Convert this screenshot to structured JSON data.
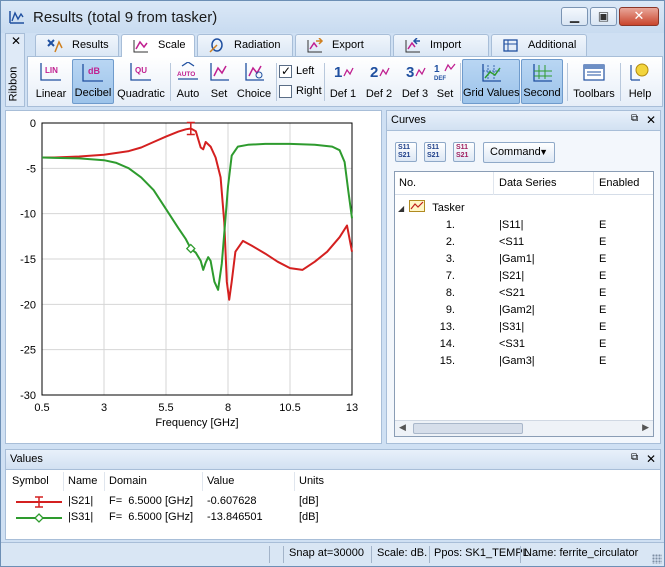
{
  "window": {
    "title": "Results (total 9 from tasker)"
  },
  "ribbon": {
    "side_label": "Ribbon",
    "tabs": [
      {
        "label": "Results"
      },
      {
        "label": "Scale"
      },
      {
        "label": "Radiation"
      },
      {
        "label": "Export"
      },
      {
        "label": "Import"
      },
      {
        "label": "Additional"
      }
    ],
    "active_tab": "Scale",
    "buttons": {
      "linear": "Linear",
      "decibel": "Decibel",
      "quadratic": "Quadratic",
      "auto": "Auto",
      "set": "Set",
      "choice": "Choice",
      "left": "Left",
      "right": "Right",
      "def1": "Def 1",
      "def2": "Def 2",
      "def3": "Def 3",
      "set2": "Set",
      "grid_values": "Grid Values",
      "second": "Second",
      "toolbars": "Toolbars",
      "help": "Help"
    },
    "icon_text": {
      "lin": "LIN",
      "db": "dB",
      "qu": "QU",
      "auto": "AUTO",
      "one": "1",
      "two": "2",
      "three": "3",
      "def": "DEF"
    },
    "left_checked": true,
    "right_checked": false
  },
  "chart_data": {
    "type": "line",
    "xlabel": "Frequency [GHz]",
    "ylabel": "",
    "xlim": [
      0.5,
      13
    ],
    "ylim": [
      -30,
      0
    ],
    "x_ticks": [
      "0.5",
      "3",
      "5.5",
      "8",
      "10.5",
      "13"
    ],
    "y_ticks": [
      "0",
      "-5",
      "-10",
      "-15",
      "-20",
      "-25",
      "-30"
    ],
    "grid": true,
    "marker_x": 6.5,
    "series": [
      {
        "name": "|S21|",
        "color": "#d42020",
        "x": [
          0.5,
          1,
          2,
          3,
          4,
          4.5,
          5,
          5.5,
          6,
          6.3,
          6.5,
          6.7,
          6.9,
          7.0,
          7.1,
          7.3,
          7.5,
          7.7,
          7.85,
          7.95,
          8.05,
          8.15,
          8.3,
          8.6,
          9,
          9.5,
          10,
          10.5,
          11,
          11.5,
          12,
          12.5,
          12.8,
          13
        ],
        "y": [
          -3.8,
          -3.8,
          -3.7,
          -3.5,
          -3.1,
          -2.7,
          -2.1,
          -1.5,
          -0.95,
          -0.7,
          -0.61,
          -0.9,
          -2.7,
          -2.9,
          -2.1,
          -2.6,
          -3.8,
          -6.0,
          -11.0,
          -17.5,
          -19.5,
          -17.5,
          -14.2,
          -13.0,
          -13.6,
          -14.4,
          -15.3,
          -16.0,
          -16.2,
          -15.3,
          -14.2,
          -12.6,
          -11.3,
          -14.2
        ]
      },
      {
        "name": "|S31|",
        "color": "#2e9b2e",
        "x": [
          0.5,
          1,
          2,
          3,
          3.5,
          4,
          4.5,
          5,
          5.5,
          6,
          6.3,
          6.5,
          6.7,
          6.9,
          7.0,
          7.1,
          7.2,
          7.3,
          7.45,
          7.6,
          7.75,
          7.9,
          8.0,
          8.15,
          8.4,
          8.8,
          9.5,
          10.5,
          11.5,
          12.2,
          12.5,
          12.7,
          12.85,
          13
        ],
        "y": [
          -3.8,
          -3.85,
          -3.9,
          -4.1,
          -4.4,
          -5.0,
          -6.0,
          -7.4,
          -9.5,
          -11.6,
          -12.8,
          -13.85,
          -14.3,
          -15.2,
          -16.2,
          -15.4,
          -14.8,
          -15.2,
          -17.5,
          -18.4,
          -15.5,
          -10.5,
          -7.0,
          -3.6,
          -2.6,
          -2.4,
          -2.3,
          -2.3,
          -2.4,
          -2.6,
          -3.0,
          -4.3,
          -7.5,
          -10.5
        ]
      }
    ]
  },
  "curves": {
    "title": "Curves",
    "toolbar_icons": [
      {
        "name": "s11-s21-sort",
        "line1": "S11",
        "line2": "S21"
      },
      {
        "name": "s11-s21-grid",
        "line1": "S11",
        "line2": "S21"
      },
      {
        "name": "s11-s21-color",
        "line1": "S11",
        "line2": "S21"
      }
    ],
    "command_label": "Command",
    "columns": [
      "No.",
      "Data Series",
      "Enabled"
    ],
    "root": "Tasker",
    "rows": [
      {
        "no": "1.",
        "series": "|S11|",
        "enabled": "E"
      },
      {
        "no": "2.",
        "series": "<S11",
        "enabled": "E"
      },
      {
        "no": "3.",
        "series": "|Gam1|",
        "enabled": "E"
      },
      {
        "no": "7.",
        "series": "|S21|",
        "enabled": "E"
      },
      {
        "no": "8.",
        "series": "<S21",
        "enabled": "E"
      },
      {
        "no": "9.",
        "series": "|Gam2|",
        "enabled": "E"
      },
      {
        "no": "13.",
        "series": "|S31|",
        "enabled": "E"
      },
      {
        "no": "14.",
        "series": "<S31",
        "enabled": "E"
      },
      {
        "no": "15.",
        "series": "|Gam3|",
        "enabled": "E"
      }
    ]
  },
  "values": {
    "title": "Values",
    "columns": [
      "Symbol",
      "Name",
      "Domain",
      "Value",
      "Units"
    ],
    "rows": [
      {
        "name": "|S21|",
        "domain": "F=  6.5000 [GHz]",
        "value": "-0.607628",
        "units": "[dB]",
        "color": "#d42020"
      },
      {
        "name": "|S31|",
        "domain": "F=  6.5000 [GHz]",
        "value": "-13.846501",
        "units": "[dB]",
        "color": "#2e9b2e"
      }
    ]
  },
  "status": {
    "snap": "Snap at=30000",
    "scale": "Scale: dB.",
    "ppos": "Ppos: SK1_TEMPL",
    "name": "Name: ferrite_circulator"
  }
}
